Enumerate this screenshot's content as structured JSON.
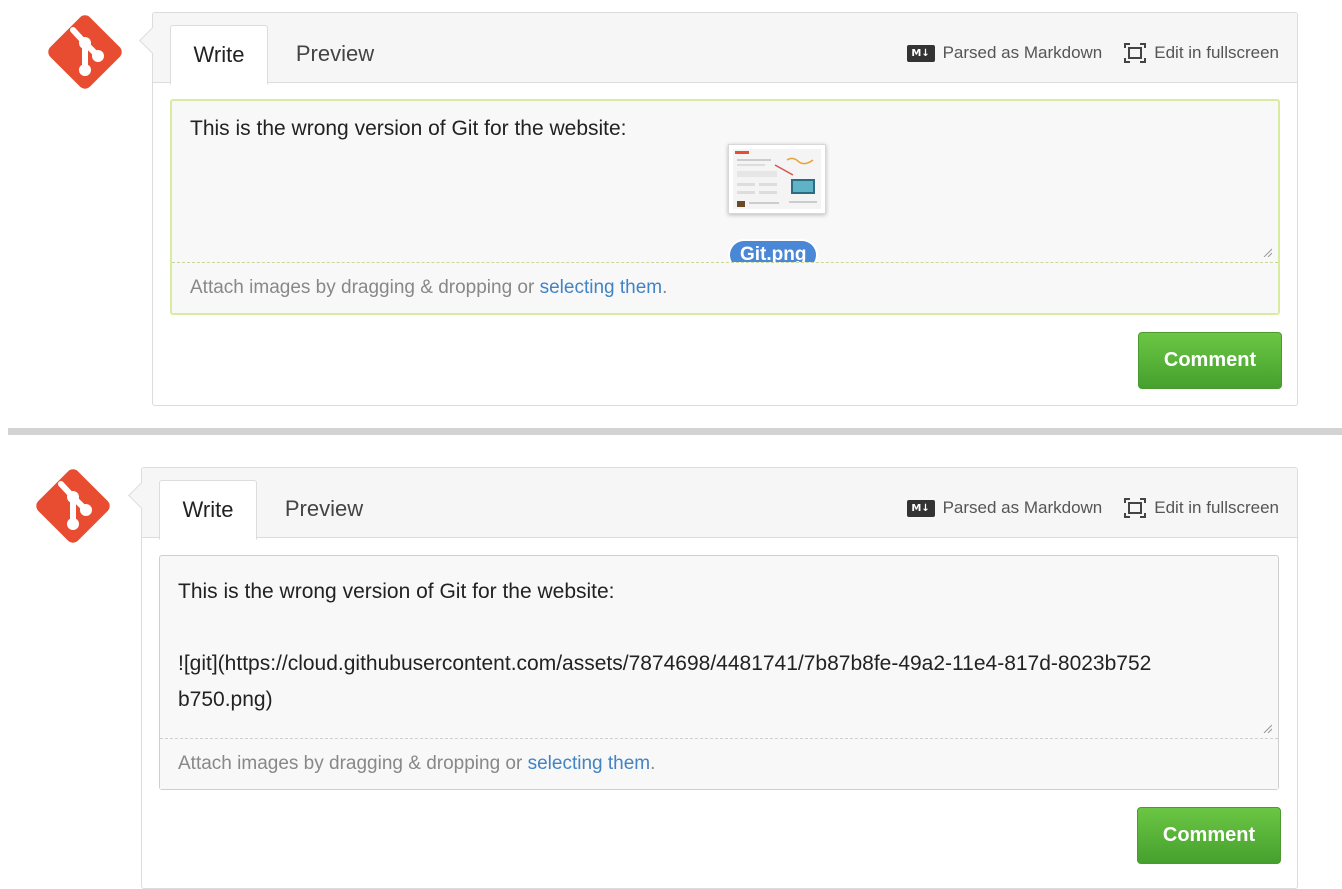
{
  "colors": {
    "logo": "#e84d31",
    "link": "#4183c4",
    "button_green": "#55b23a",
    "focus_border": "#d9eba0",
    "badge": "#4a87d6"
  },
  "panel_top": {
    "tabs": {
      "write": "Write",
      "preview": "Preview"
    },
    "tools": {
      "markdown_icon_text": "M↓",
      "markdown_label": "Parsed as Markdown",
      "fullscreen_label": "Edit in fullscreen"
    },
    "textarea_value": "This is the wrong version of Git for the website:",
    "drag_file_name": "Git.png",
    "drop_hint": {
      "text": "Attach images by dragging & dropping or ",
      "link": "selecting them",
      "suffix": "."
    },
    "button": "Comment"
  },
  "panel_bottom": {
    "tabs": {
      "write": "Write",
      "preview": "Preview"
    },
    "tools": {
      "markdown_icon_text": "M↓",
      "markdown_label": "Parsed as Markdown",
      "fullscreen_label": "Edit in fullscreen"
    },
    "textarea_value": "This is the wrong version of Git for the website:\n\n![git](https://cloud.githubusercontent.com/assets/7874698/4481741/7b87b8fe-49a2-11e4-817d-8023b752b750.png)",
    "drop_hint": {
      "text": "Attach images by dragging & dropping or ",
      "link": "selecting them",
      "suffix": "."
    },
    "button": "Comment"
  }
}
